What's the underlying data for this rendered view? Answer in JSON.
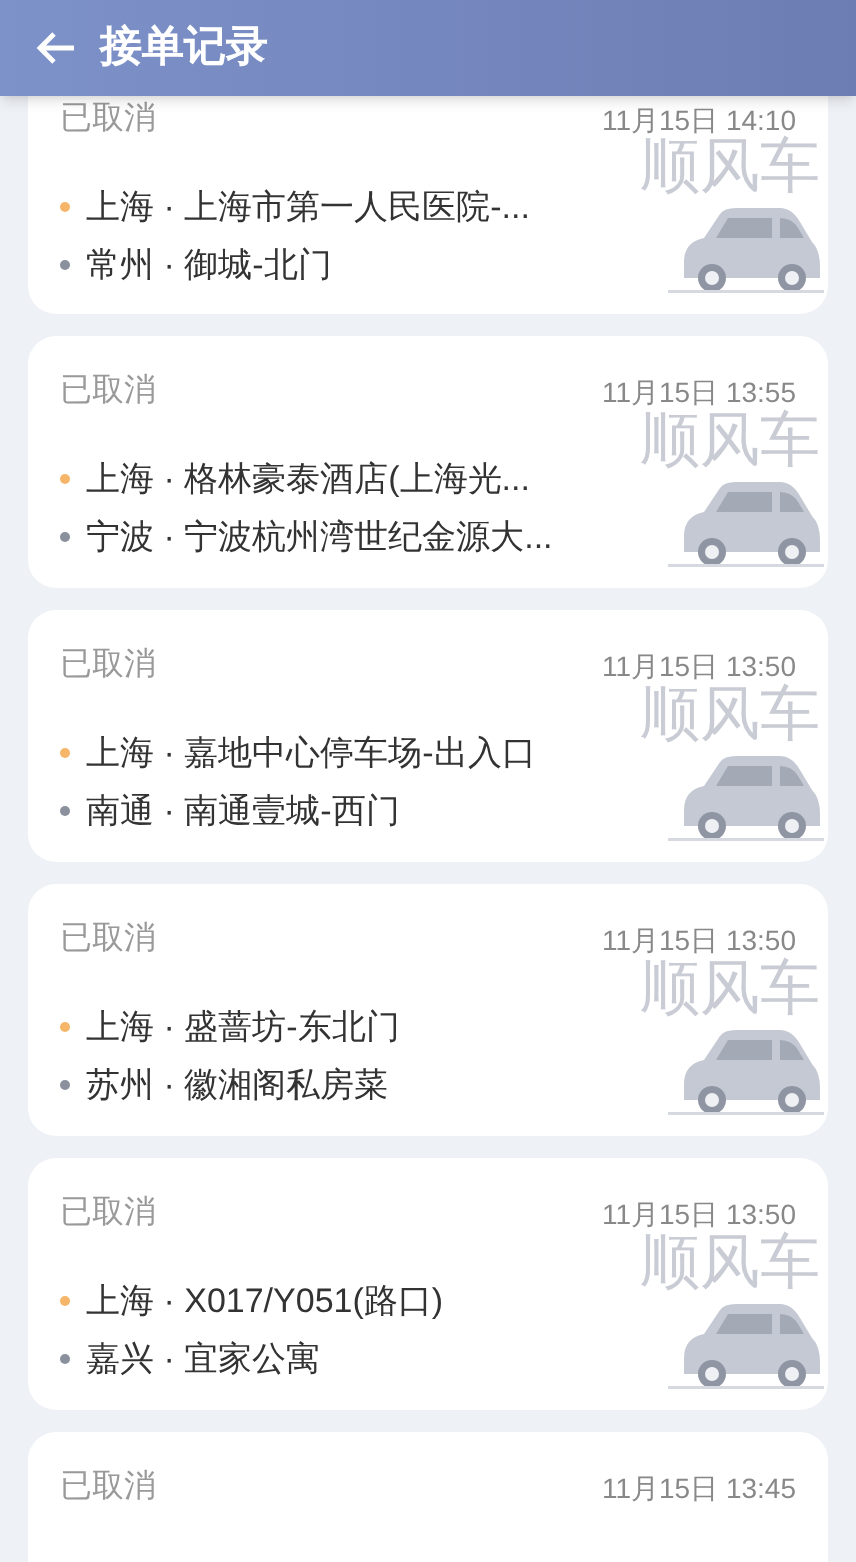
{
  "header": {
    "title": "接单记录"
  },
  "orders": [
    {
      "status": "已取消",
      "time": "11月15日 14:10",
      "tag": "顺风车",
      "from": "上海 · 上海市第一人民医院-...",
      "to": "常州 · 御城-北门"
    },
    {
      "status": "已取消",
      "time": "11月15日 13:55",
      "tag": "顺风车",
      "from": "上海 · 格林豪泰酒店(上海光...",
      "to": "宁波 · 宁波杭州湾世纪金源大..."
    },
    {
      "status": "已取消",
      "time": "11月15日 13:50",
      "tag": "顺风车",
      "from": "上海 · 嘉地中心停车场-出入口",
      "to": "南通 · 南通壹城-西门"
    },
    {
      "status": "已取消",
      "time": "11月15日 13:50",
      "tag": "顺风车",
      "from": "上海 · 盛蔷坊-东北门",
      "to": "苏州 · 徽湘阁私房菜"
    },
    {
      "status": "已取消",
      "time": "11月15日 13:50",
      "tag": "顺风车",
      "from": "上海 · X017/Y051(路口)",
      "to": "嘉兴 · 宜家公寓"
    },
    {
      "status": "已取消",
      "time": "11月15日 13:45"
    }
  ]
}
